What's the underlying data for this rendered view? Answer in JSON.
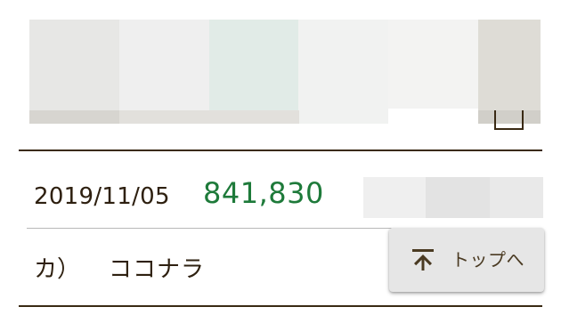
{
  "header_mosaic": {
    "colors": [
      "#e7e7e5",
      "#efefef",
      "#e1ebe7",
      "#f1f2f1",
      "#f3f3f2",
      "#dedcd6"
    ],
    "band_colors": [
      "#d7d5d0",
      "#e2e0dc",
      "#d1cfc9"
    ]
  },
  "row": {
    "date": "2019/11/05",
    "amount": "841,830",
    "amount_color": "#1e7a3a",
    "mosaic_colors": [
      "#efefef",
      "#e3e3e3",
      "#e9e9e9"
    ]
  },
  "next_row": {
    "prefix": "カ）",
    "name": "ココナラ"
  },
  "scroll_top_button": {
    "label": "トップへ",
    "icon": "arrow-up-to-bar-icon"
  }
}
